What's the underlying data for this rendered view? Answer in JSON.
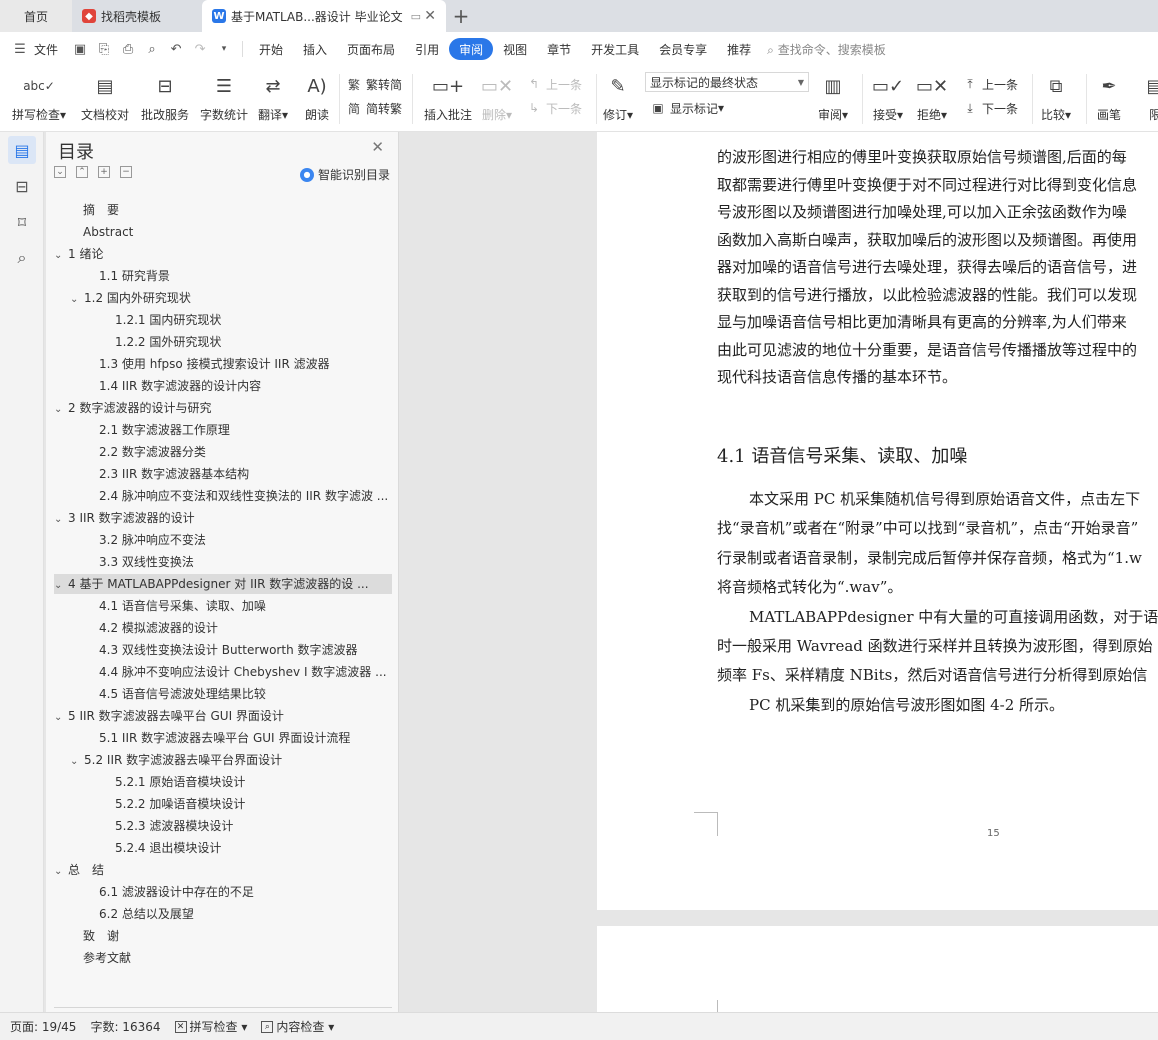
{
  "tabs": [
    {
      "label": "首页"
    },
    {
      "label": "找稻壳模板"
    },
    {
      "label": "基于MATLAB...器设计 毕业论文"
    }
  ],
  "menu": {
    "file": "文件",
    "items": [
      "开始",
      "插入",
      "页面布局",
      "引用",
      "审阅",
      "视图",
      "章节",
      "开发工具",
      "会员专享",
      "推荐"
    ],
    "active": "审阅",
    "search": "查找命令、搜索模板"
  },
  "ribbon": {
    "spellcheck": "拼写检查",
    "doc_proof": "文档校对",
    "batch": "批改服务",
    "wordcount": "字数统计",
    "translate": "翻译",
    "read": "朗读",
    "trad": "繁转简",
    "simp": "简转繁",
    "insert_comment": "插入批注",
    "delete": "删除",
    "prev": "上一条",
    "next": "下一条",
    "revise": "修订",
    "markup_select": "显示标记的最终状态",
    "show_markup": "显示标记",
    "review": "审阅",
    "accept": "接受",
    "reject": "拒绝",
    "prev2": "上一条",
    "next2": "下一条",
    "compare": "比较",
    "pen": "画笔",
    "limit": "限"
  },
  "toc": {
    "title": "目录",
    "smart": "智能识别目录",
    "items": [
      {
        "text": "摘　要"
      },
      {
        "text": "Abstract"
      },
      {
        "text": "1 绪论"
      },
      {
        "text": "1.1 研究背景"
      },
      {
        "text": "1.2 国内外研究现状"
      },
      {
        "text": "1.2.1 国内研究现状"
      },
      {
        "text": "1.2.2 国外研究现状"
      },
      {
        "text": "1.3 使用 hfpso 接模式搜索设计 IIR 滤波器"
      },
      {
        "text": "1.4 IIR 数字滤波器的设计内容"
      },
      {
        "text": "2 数字滤波器的设计与研究"
      },
      {
        "text": "2.1 数字滤波器工作原理"
      },
      {
        "text": "2.2 数字滤波器分类"
      },
      {
        "text": "2.3 IIR 数字滤波器基本结构"
      },
      {
        "text": "2.4 脉冲响应不变法和双线性变换法的 IIR 数字滤波 ..."
      },
      {
        "text": "3 IIR 数字滤波器的设计"
      },
      {
        "text": "3.2 脉冲响应不变法"
      },
      {
        "text": "3.3 双线性变换法"
      },
      {
        "text": "4 基于 MATLABAPPdesigner 对 IIR 数字滤波器的设 ..."
      },
      {
        "text": "4.1 语音信号采集、读取、加噪"
      },
      {
        "text": "4.2 模拟滤波器的设计"
      },
      {
        "text": "4.3 双线性变换法设计 Butterworth 数字滤波器"
      },
      {
        "text": "4.4 脉冲不变响应法设计 Chebyshev I 数字滤波器 ..."
      },
      {
        "text": "4.5 语音信号滤波处理结果比较"
      },
      {
        "text": "5 IIR 数字滤波器去噪平台 GUI 界面设计"
      },
      {
        "text": "5.1 IIR 数字滤波器去噪平台 GUI 界面设计流程"
      },
      {
        "text": "5.2 IIR 数字滤波器去噪平台界面设计"
      },
      {
        "text": "5.2.1 原始语音模块设计"
      },
      {
        "text": "5.2.2 加噪语音模块设计"
      },
      {
        "text": "5.2.3 滤波器模块设计"
      },
      {
        "text": "5.2.4 退出模块设计"
      },
      {
        "text": "总　结"
      },
      {
        "text": "6.1 滤波器设计中存在的不足"
      },
      {
        "text": "6.2 总结以及展望"
      },
      {
        "text": "致　谢"
      },
      {
        "text": "参考文献"
      }
    ]
  },
  "doc": {
    "lines": [
      "的波形图进行相应的傅里叶变换获取原始信号频谱图,后面的每",
      "取都需要进行傅里叶变换便于对不同过程进行对比得到变化信息",
      "号波形图以及频谱图进行加噪处理,可以加入正余弦函数作为噪",
      "函数加入高斯白噪声，获取加噪后的波形图以及频谱图。再使用",
      "器对加噪的语音信号进行去噪处理，获得去噪后的语音信号，进",
      "获取到的信号进行播放，以此检验滤波器的性能。我们可以发现",
      "显与加噪语音信号相比更加清晰具有更高的分辨率,为人们带来",
      "由此可见滤波的地位十分重要，是语音信号传播播放等过程中的",
      "现代科技语音信息传播的基本环节。"
    ],
    "heading": "4.1  语音信号采集、读取、加噪",
    "lines2": [
      "本文采用 PC 机采集随机信号得到原始语音文件，点击左下",
      "找“录音机”或者在“附录”中可以找到“录音机”，点击“开始录音”",
      "行录制或者语音录制，录制完成后暂停并保存音频，格式为“1.w",
      "将音频格式转化为“.wav”。",
      "MATLABAPPdesigner 中有大量的可直接调用函数，对于语",
      "时一般采用 Wavread 函数进行采样并且转换为波形图，得到原始",
      "频率 Fs、采样精度 NBits，然后对语音信号进行分析得到原始信",
      "PC 机采集到的原始信号波形图如图 4-2 所示。"
    ],
    "page_number": "15"
  },
  "status": {
    "page": "页面: 19/45",
    "words": "字数: 16364",
    "spell": "拼写检查",
    "content": "内容检查"
  }
}
